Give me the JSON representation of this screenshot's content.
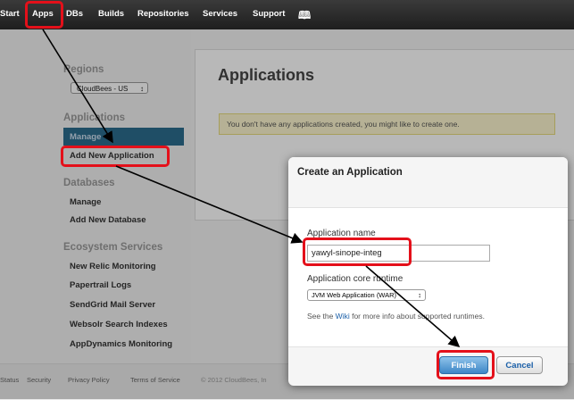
{
  "nav": {
    "items": [
      "Start",
      "Apps",
      "DBs",
      "Builds",
      "Repositories",
      "Services",
      "Support"
    ],
    "book_icon": "book-icon"
  },
  "sidebar": {
    "regions_heading": "Regions",
    "region_value": "CloudBees - US",
    "applications_heading": "Applications",
    "app_items": [
      "Manage",
      "Add New Application"
    ],
    "databases_heading": "Databases",
    "db_items": [
      "Manage",
      "Add New Database"
    ],
    "ecosystem_heading": "Ecosystem Services",
    "eco_items": [
      "New Relic Monitoring",
      "Papertrail Logs",
      "SendGrid Mail Server",
      "Websolr Search Indexes",
      "AppDynamics Monitoring"
    ]
  },
  "main": {
    "title": "Applications",
    "notice": "You don't have any applications created, you might like to create one."
  },
  "footer": {
    "links": [
      "Status",
      "Security",
      "Privacy Policy",
      "Terms of Service"
    ],
    "copyright": "© 2012 CloudBees, In"
  },
  "modal": {
    "title": "Create an Application",
    "app_name_label": "Application name",
    "app_name_value": "yawyl-sinope-integ",
    "runtime_label": "Application core runtime",
    "runtime_value": "JVM Web Application (WAR)",
    "wiki_prefix": "See the ",
    "wiki_link": "Wiki",
    "wiki_suffix": " for more info about supported runtimes.",
    "finish_label": "Finish",
    "cancel_label": "Cancel"
  },
  "colors": {
    "highlight": "#e4101a",
    "selected_nav": "#2b6d8e",
    "accent_link": "#1a5fa8"
  }
}
